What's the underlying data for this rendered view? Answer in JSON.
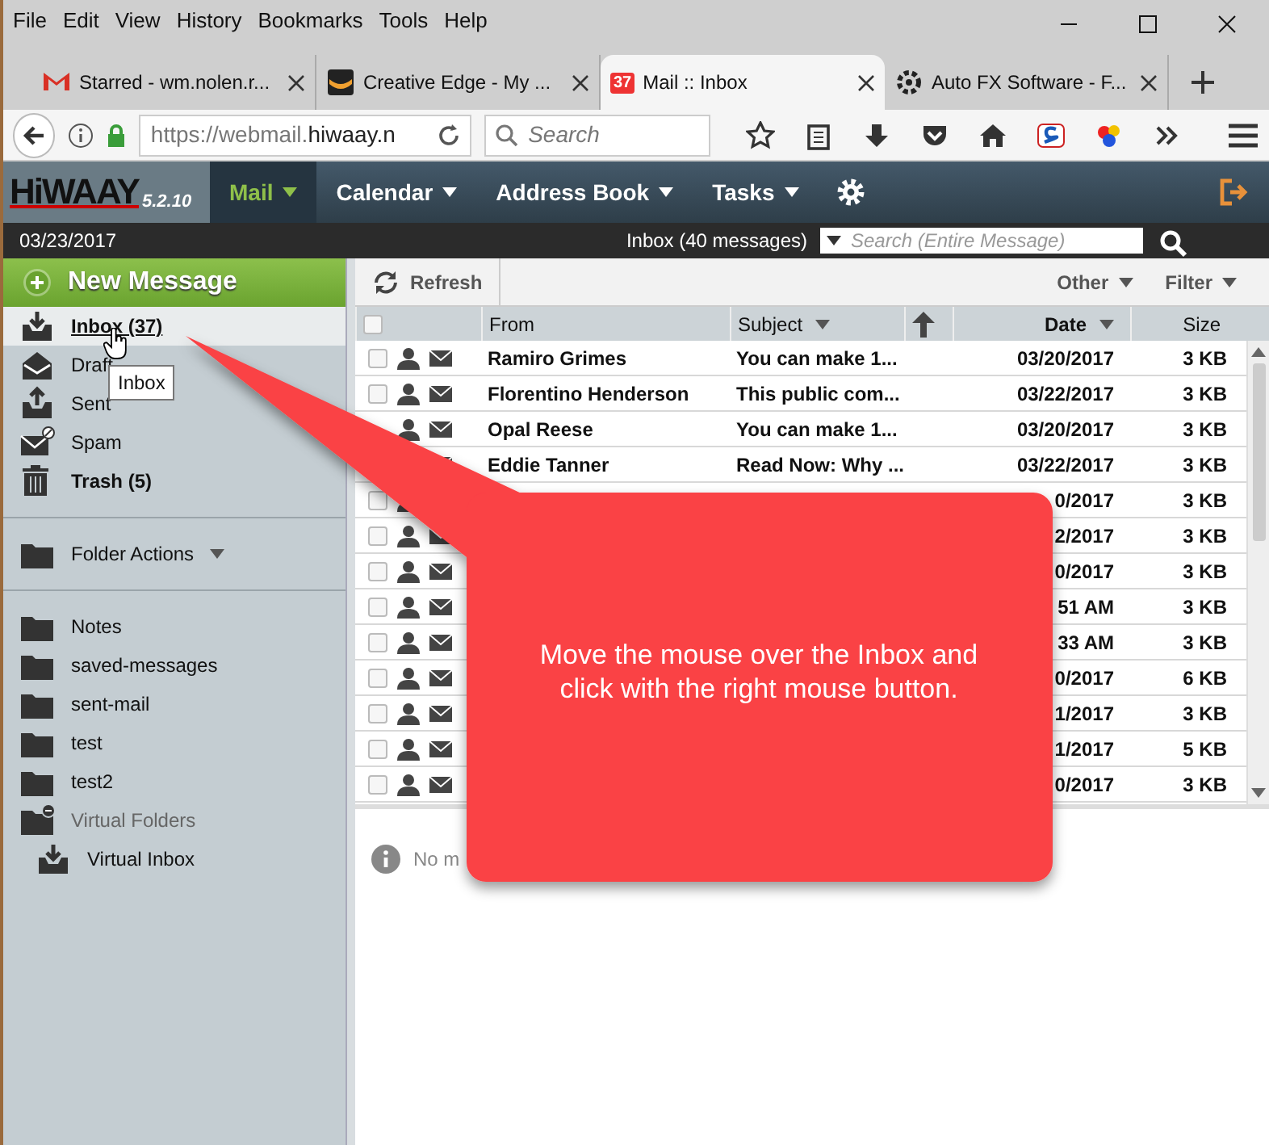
{
  "menu_bar": [
    "File",
    "Edit",
    "View",
    "History",
    "Bookmarks",
    "Tools",
    "Help"
  ],
  "tabs": [
    {
      "title": "Starred - wm.nolen.r...",
      "kind": "gmail",
      "selected": false
    },
    {
      "title": "Creative Edge - My ...",
      "kind": "edge",
      "selected": false
    },
    {
      "title": "Mail :: Inbox",
      "kind": "mail",
      "badge": "37",
      "selected": true
    },
    {
      "title": "Auto FX Software - F...",
      "kind": "autofx",
      "selected": false
    }
  ],
  "address_bar": {
    "url": "https://webmail.",
    "host": "hiwaay.n"
  },
  "browser_search": {
    "placeholder": "Search"
  },
  "app": {
    "logo": "HiWAAY",
    "version": "5.2.10",
    "nav": [
      {
        "label": "Mail",
        "selected": true
      },
      {
        "label": "Calendar",
        "selected": false
      },
      {
        "label": "Address Book",
        "selected": false
      },
      {
        "label": "Tasks",
        "selected": false
      }
    ]
  },
  "status_bar": {
    "date": "03/23/2017",
    "mailbox": "Inbox (40 messages)",
    "search_placeholder": "Search (Entire Message)"
  },
  "new_message": "New Message",
  "folders": [
    {
      "label": "Inbox (37)",
      "kind": "inbox",
      "unread": true,
      "selected": true
    },
    {
      "label": "Draft",
      "kind": "drafts",
      "unread": false,
      "selected": false
    },
    {
      "label": "Sent",
      "kind": "sent",
      "unread": false,
      "selected": false
    },
    {
      "label": "Spam",
      "kind": "spam",
      "unread": false,
      "selected": false
    },
    {
      "label": "Trash (5)",
      "kind": "trash",
      "unread": true,
      "selected": false
    }
  ],
  "folder_actions": "Folder Actions",
  "user_folders": [
    {
      "label": "Notes",
      "kind": "folder"
    },
    {
      "label": "saved-messages",
      "kind": "folder"
    },
    {
      "label": "sent-mail",
      "kind": "folder"
    },
    {
      "label": "test",
      "kind": "folder"
    },
    {
      "label": "test2",
      "kind": "folder"
    },
    {
      "label": "Virtual Folders",
      "kind": "virtual",
      "children": [
        {
          "label": "Virtual Inbox",
          "kind": "inbox"
        }
      ]
    }
  ],
  "toolbar": {
    "refresh": "Refresh",
    "other": "Other",
    "filter": "Filter"
  },
  "table": {
    "columns": [
      {
        "label": "From",
        "sorted": false
      },
      {
        "label": "Subject",
        "sorted": false
      },
      {
        "label": "Date",
        "sorted": true
      },
      {
        "label": "Size",
        "sorted": false
      }
    ],
    "rows": [
      {
        "from": "Ramiro Grimes",
        "subject": "You can make 1...",
        "date": "03/20/2017",
        "size": "3 KB",
        "checked": false
      },
      {
        "from": "Florentino Henderson",
        "subject": "This public com...",
        "date": "03/22/2017",
        "size": "3 KB",
        "checked": false
      },
      {
        "from": "Opal Reese",
        "subject": "You can make 1...",
        "date": "03/20/2017",
        "size": "3 KB"
      },
      {
        "from": "Eddie Tanner",
        "subject": "Read Now: Why ...",
        "date": "03/22/2017",
        "size": "3 KB",
        "person_shown": false
      },
      {
        "date": "0/2017",
        "size": "3 KB",
        "checked": false,
        "envelope_shown": false
      },
      {
        "date": "2/2017",
        "size": "3 KB",
        "checked": false
      },
      {
        "date": "0/2017",
        "size": "3 KB",
        "checked": false
      },
      {
        "date": "51 AM",
        "size": "3 KB",
        "checked": false
      },
      {
        "date": "33 AM",
        "size": "3 KB",
        "checked": false
      },
      {
        "date": "0/2017",
        "size": "6 KB",
        "checked": false
      },
      {
        "date": "1/2017",
        "size": "3 KB",
        "checked": false
      },
      {
        "date": "1/2017",
        "size": "5 KB",
        "checked": false
      },
      {
        "date": "0/2017",
        "size": "3 KB",
        "checked": false
      }
    ],
    "all_checked": false
  },
  "preview": {
    "message": "No m"
  },
  "tooltip": "Inbox",
  "callout": {
    "text": "Move the mouse over the Inbox and click with the right mouse button."
  }
}
